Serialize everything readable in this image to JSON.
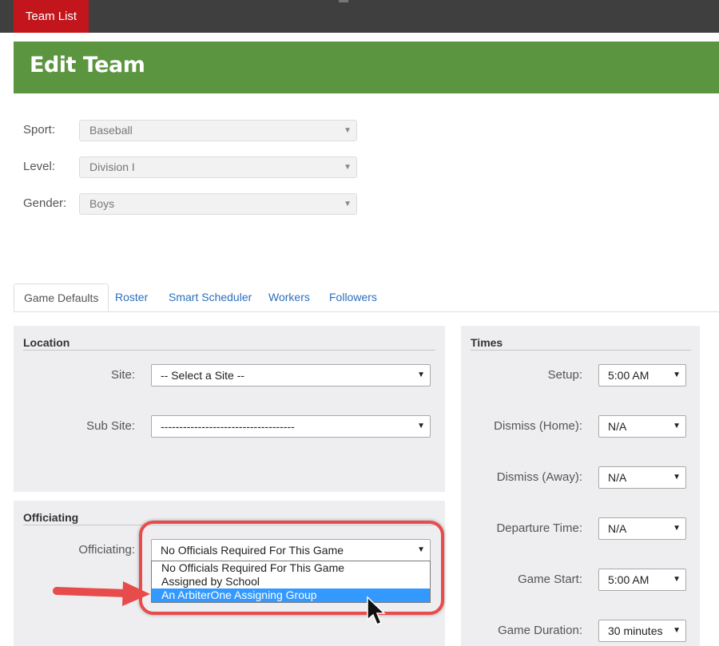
{
  "topbar": {
    "team_list_label": "Team List"
  },
  "page": {
    "title": "Edit Team"
  },
  "team": {
    "sport_label": "Sport:",
    "sport_value": "Baseball",
    "level_label": "Level:",
    "level_value": "Division I",
    "gender_label": "Gender:",
    "gender_value": "Boys"
  },
  "tabs": [
    "Game Defaults",
    "Roster",
    "Smart Scheduler",
    "Workers",
    "Followers"
  ],
  "location": {
    "title": "Location",
    "site_label": "Site:",
    "site_value": "-- Select a Site --",
    "subsite_label": "Sub Site:",
    "subsite_value": "------------------------------------"
  },
  "officiating": {
    "title": "Officiating",
    "label": "Officiating:",
    "value": "No Officials Required For This Game",
    "options": [
      "No Officials Required For This Game",
      "Assigned by School",
      "An ArbiterOne Assigning Group"
    ],
    "selected_option": "An ArbiterOne Assigning Group"
  },
  "times": {
    "title": "Times",
    "setup_label": "Setup:",
    "setup_value": "5:00 AM",
    "dismiss_home_label": "Dismiss (Home):",
    "dismiss_home_value": "N/A",
    "dismiss_away_label": "Dismiss (Away):",
    "dismiss_away_value": "N/A",
    "departure_label": "Departure Time:",
    "departure_value": "N/A",
    "game_start_label": "Game Start:",
    "game_start_value": "5:00 AM",
    "game_duration_label": "Game Duration:",
    "game_duration_value": "30 minutes"
  },
  "colors": {
    "header_green": "#5b9540",
    "topbar_red": "#c3161c",
    "link_blue": "#2a6fbd",
    "selection_blue": "#3399ff",
    "annotation_red": "#e84b4b"
  }
}
